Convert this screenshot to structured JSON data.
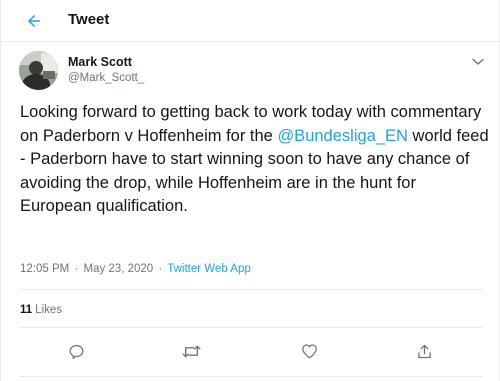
{
  "header": {
    "title": "Tweet",
    "back_icon": "arrow-left-icon"
  },
  "colors": {
    "accent": "#1da1f2",
    "text": "#14171a",
    "muted": "#657786",
    "border": "#e6ecf0"
  },
  "tweet": {
    "author": {
      "name": "Mark Scott",
      "handle": "@Mark_Scott_"
    },
    "text_before": "Looking forward to getting back to work today with commentary on Paderborn v Hoffenheim for the ",
    "mention": "@Bundesliga_EN",
    "text_after": " world feed - Paderborn have to start winning soon to have any chance of avoiding the drop, while Hoffenheim are in the hunt for European qualification.",
    "time": "12:05 PM",
    "separator": "·",
    "date": "May 23, 2020",
    "source": "Twitter Web App",
    "likes_count": "11",
    "likes_label": "Likes"
  },
  "actions": [
    {
      "name": "reply",
      "icon": "reply-icon"
    },
    {
      "name": "retweet",
      "icon": "retweet-icon"
    },
    {
      "name": "like",
      "icon": "heart-icon"
    },
    {
      "name": "share",
      "icon": "share-icon"
    }
  ]
}
